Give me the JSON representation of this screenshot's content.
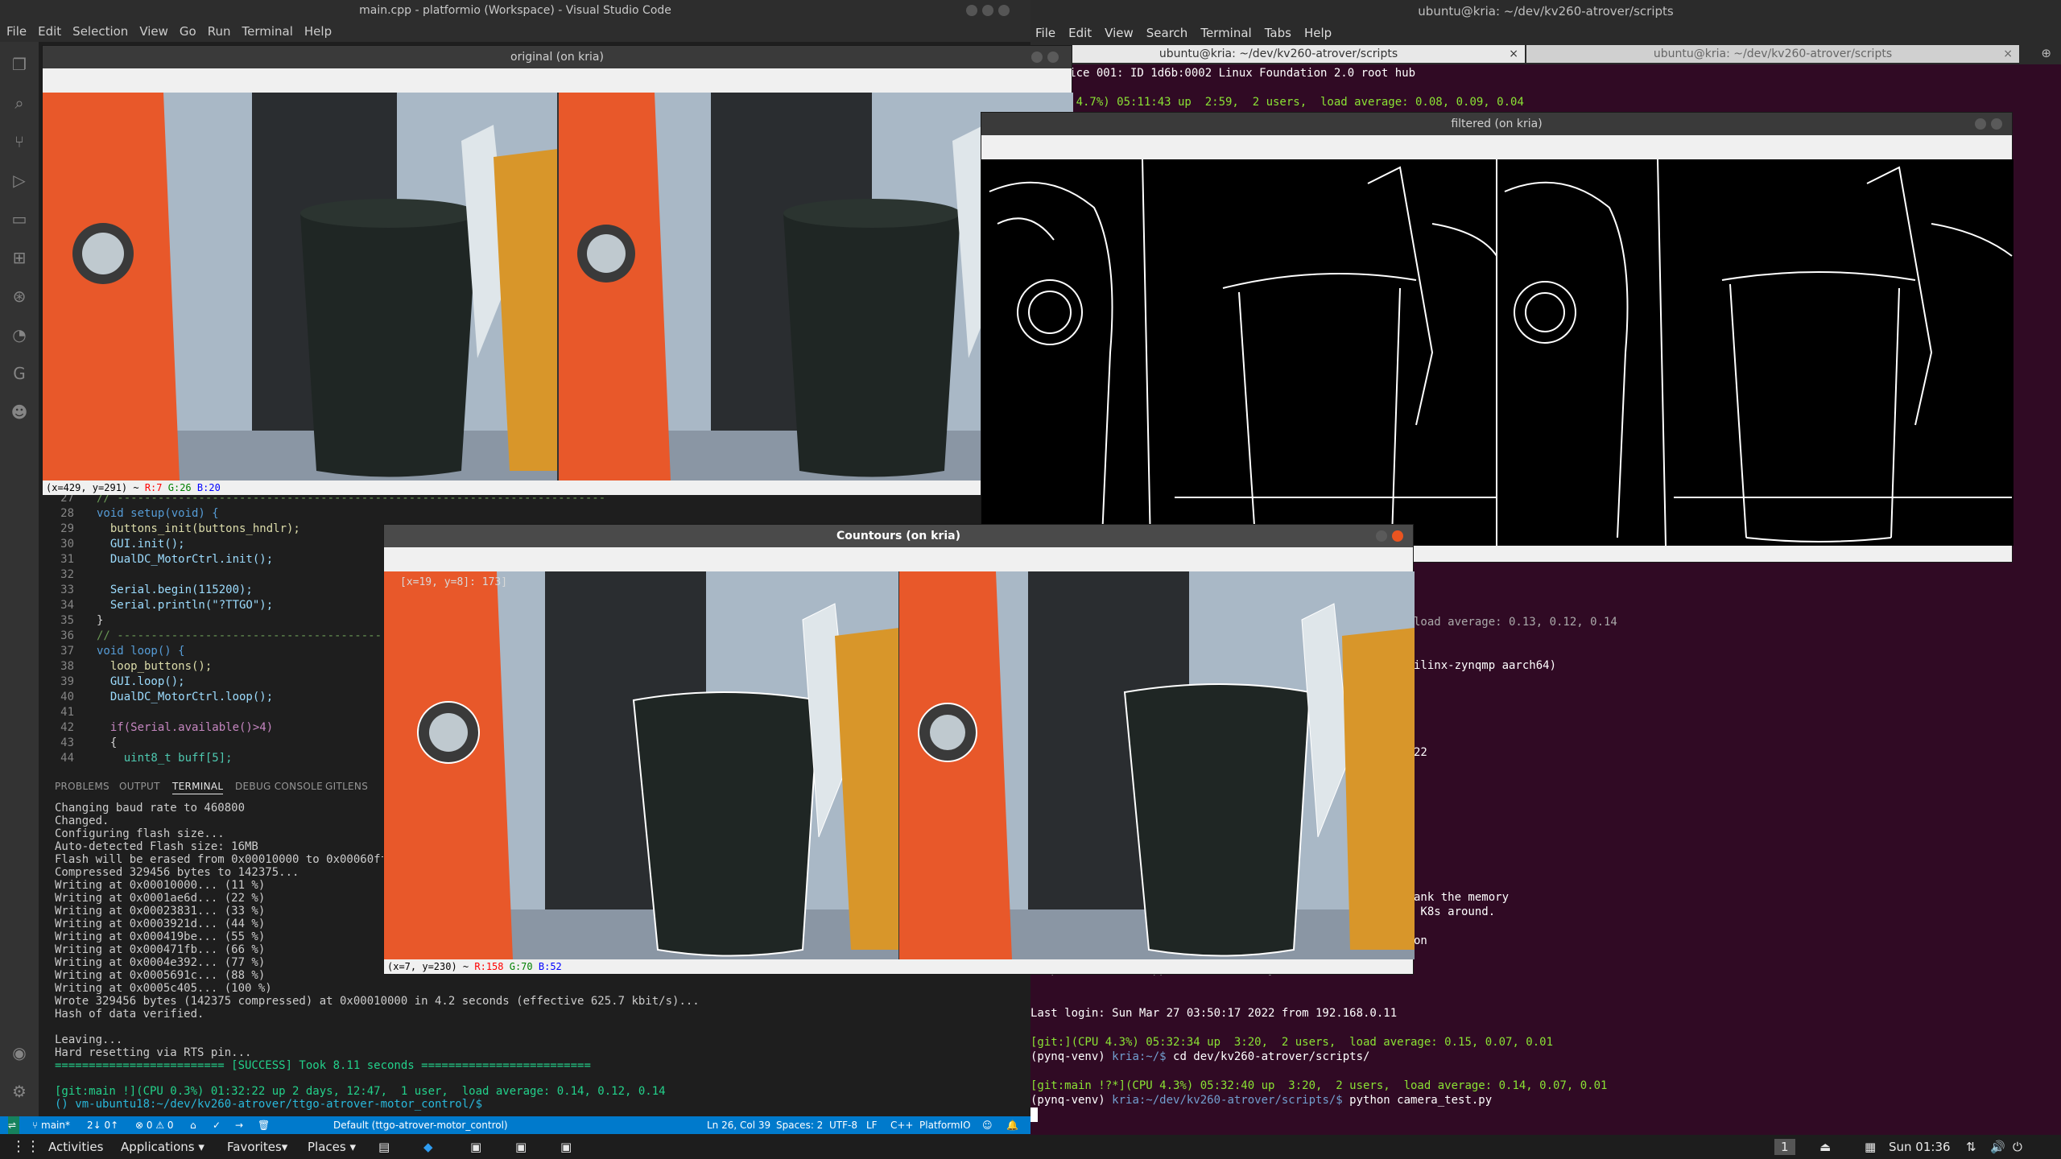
{
  "vscode": {
    "title": "main.cpp - platformio (Workspace) - Visual Studio Code",
    "menu": [
      "File",
      "Edit",
      "Selection",
      "View",
      "Go",
      "Run",
      "Terminal",
      "Help"
    ],
    "code_lines": [
      {
        "n": "27",
        "text": "// ------------------------------------------------------------------------"
      },
      {
        "n": "28",
        "text": "void setup(void) {"
      },
      {
        "n": "29",
        "text": "  buttons_init(buttons_hndlr);"
      },
      {
        "n": "30",
        "text": "  GUI.init();"
      },
      {
        "n": "31",
        "text": "  DualDC_MotorCtrl.init();"
      },
      {
        "n": "32",
        "text": ""
      },
      {
        "n": "33",
        "text": "  Serial.begin(115200);"
      },
      {
        "n": "34",
        "text": "  Serial.println(\"?TTGO\");"
      },
      {
        "n": "35",
        "text": "}"
      },
      {
        "n": "36",
        "text": "// ------------------------------------------------------------------------"
      },
      {
        "n": "37",
        "text": "void loop() {"
      },
      {
        "n": "38",
        "text": "  loop_buttons();"
      },
      {
        "n": "39",
        "text": "  GUI.loop();"
      },
      {
        "n": "40",
        "text": "  DualDC_MotorCtrl.loop();"
      },
      {
        "n": "41",
        "text": ""
      },
      {
        "n": "42",
        "text": "  if(Serial.available()>4)"
      },
      {
        "n": "43",
        "text": "  {"
      },
      {
        "n": "44",
        "text": "    uint8_t buff[5];"
      }
    ],
    "panel_tabs": [
      "PROBLEMS",
      "OUTPUT",
      "TERMINAL",
      "DEBUG CONSOLE",
      "GITLENS"
    ],
    "active_panel_tab": "TERMINAL",
    "terminal_lines": [
      "Changing baud rate to 460800",
      "Changed.",
      "Configuring flash size...",
      "Auto-detected Flash size: 16MB",
      "Flash will be erased from 0x00010000 to 0x00060fff...",
      "Compressed 329456 bytes to 142375...",
      "Writing at 0x00010000... (11 %)",
      "Writing at 0x0001ae6d... (22 %)",
      "Writing at 0x00023831... (33 %)",
      "Writing at 0x0003921d... (44 %)",
      "Writing at 0x000419be... (55 %)",
      "Writing at 0x000471fb... (66 %)",
      "Writing at 0x0004e392... (77 %)",
      "Writing at 0x0005691c... (88 %)",
      "Writing at 0x0005c405... (100 %)",
      "Wrote 329456 bytes (142375 compressed) at 0x00010000 in 4.2 seconds (effective 625.7 kbit/s)...",
      "Hash of data verified.",
      "",
      "Leaving...",
      "Hard resetting via RTS pin...",
      "========================= [SUCCESS] Took 8.11 seconds ========================="
    ],
    "prompt1": "[git:main !](CPU 0.3%) 01:32:22 up 2 days, 12:47,  1 user,  load average: 0.14, 0.12, 0.14",
    "prompt2": "() vm-ubuntu18:~/dev/kv260-atrover/ttgo-atrover-motor_control/$ ",
    "status": {
      "branch": "main*",
      "sync": "2↓ 0↑",
      "errors": "⊗ 0 ⚠ 0",
      "env": "Default (ttgo-atrover-motor_control)",
      "position": "Ln 26, Col 39",
      "spaces": "Spaces: 2",
      "encoding": "UTF-8",
      "eol": "LF",
      "lang": "C++",
      "platform": "PlatformIO"
    }
  },
  "terminal": {
    "title": "ubuntu@kria: ~/dev/kv260-atrover/scripts",
    "menu": [
      "File",
      "Edit",
      "View",
      "Search",
      "Terminal",
      "Tabs",
      "Help"
    ],
    "tabs": [
      "ubuntu@kria: ~/dev/kv260-atrover/scripts",
      "ubuntu@kria: ~/dev/kv260-atrover/scripts"
    ],
    "lines_top": [
      "1 Device 001: ID 1d6b:0002 Linux Foundation 2.0 root hub",
      "](CPU 4.7%) 05:11:43 up  2:59,  2 users,  load average: 0.08, 0.09, 0.04"
    ],
    "partial_lines": [
      "load average: 0.13, 0.12, 0.14",
      "ilinx-zynqmp aarch64)",
      "22",
      "ank the memory",
      " K8s around.",
      "on"
    ],
    "bottom_lines": {
      "updates": "0 updates can be applied immediately.",
      "last_login": "Last login: Sun Mar 27 03:50:17 2022 from 192.168.0.11",
      "p1_status": "[git:](CPU 4.3%) 05:32:34 up  3:20,  2 users,  load average: 0.15, 0.07, 0.01",
      "p1_cmd_prefix": "(pynq-venv) ",
      "p1_path": "kria:~/$",
      "p1_cmd": " cd dev/kv260-atrover/scripts/",
      "p2_status": "[git:main !?*](CPU 4.3%) 05:32:40 up  3:20,  2 users,  load average: 0.14, 0.07, 0.01",
      "p2_cmd_prefix": "(pynq-venv) ",
      "p2_path": "kria:~/dev/kv260-atrover/scripts/$",
      "p2_cmd": " python camera_test.py"
    }
  },
  "windows": {
    "original": {
      "title": "original (on kria)",
      "status": "(x=429, y=291) ~ ",
      "r": "R:7",
      "g": "G:26",
      "b": "B:20"
    },
    "filtered": {
      "title": "filtered (on kria)"
    },
    "contours": {
      "title": "Countours (on kria)",
      "status": "(x=7, y=230) ~ ",
      "r": "R:158",
      "g": "G:70",
      "b": "B:52",
      "overlay": "[x=19, y=8]: 173]"
    }
  },
  "panel": {
    "activities": "Activities",
    "applications": "Applications ▾",
    "favorites": "Favorites▾",
    "places": "Places ▾",
    "workspace": "1",
    "clock": "Sun 01:36"
  },
  "colors": {
    "vscode_status": "#007acc",
    "terminal_bg": "#300a24",
    "ubuntu_orange": "#e95420"
  }
}
